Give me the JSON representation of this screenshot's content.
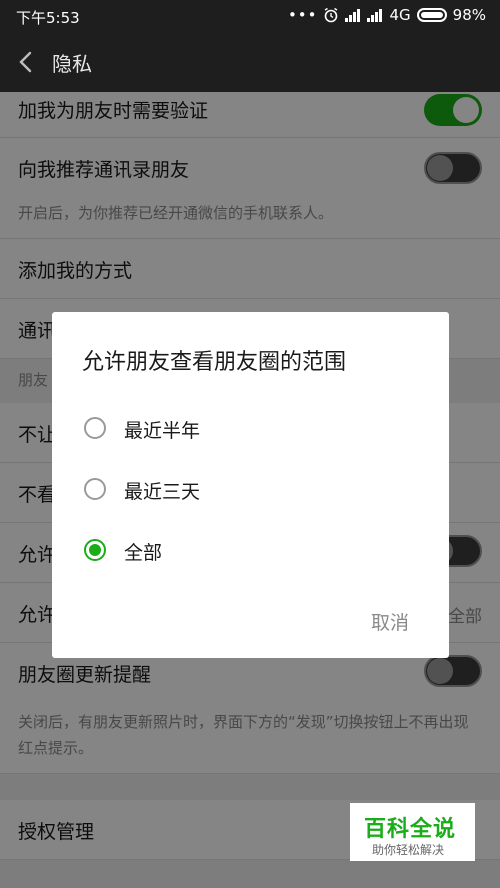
{
  "status": {
    "time": "下午5:53",
    "dots": "•••",
    "network": "4G",
    "battery": "98%"
  },
  "header": {
    "title": "隐私"
  },
  "settings": {
    "verify_friend": {
      "label": "加我为朋友时需要验证",
      "enabled": true
    },
    "recommend_contacts": {
      "label": "向我推荐通讯录朋友",
      "enabled": false
    },
    "recommend_hint": "开启后，为你推荐已经开通微信的手机联系人。",
    "add_methods": {
      "label": "添加我的方式"
    },
    "address_book": {
      "label": "通讯"
    },
    "moments_section": "朋友",
    "hide_from": {
      "label": "不让"
    },
    "dont_see": {
      "label": "不看"
    },
    "allow_stranger": {
      "label": "允许",
      "enabled": false
    },
    "allow_range": {
      "label": "允许",
      "value": "全部"
    },
    "moments_update": {
      "label": "朋友圈更新提醒",
      "enabled": false
    },
    "moments_update_hint": "关闭后，有朋友更新照片时，界面下方的“发现”切换按钮上不再出现红点提示。",
    "authorization": {
      "label": "授权管理"
    }
  },
  "dialog": {
    "title": "允许朋友查看朋友圈的范围",
    "options": [
      {
        "label": "最近半年",
        "selected": false
      },
      {
        "label": "最近三天",
        "selected": false
      },
      {
        "label": "全部",
        "selected": true
      }
    ],
    "cancel_label": "取消"
  },
  "watermark": {
    "line1": "百科全说",
    "line2": "助你轻松解决"
  },
  "colors": {
    "accent": "#1aad19",
    "titlebar": "#1e1e1e"
  }
}
